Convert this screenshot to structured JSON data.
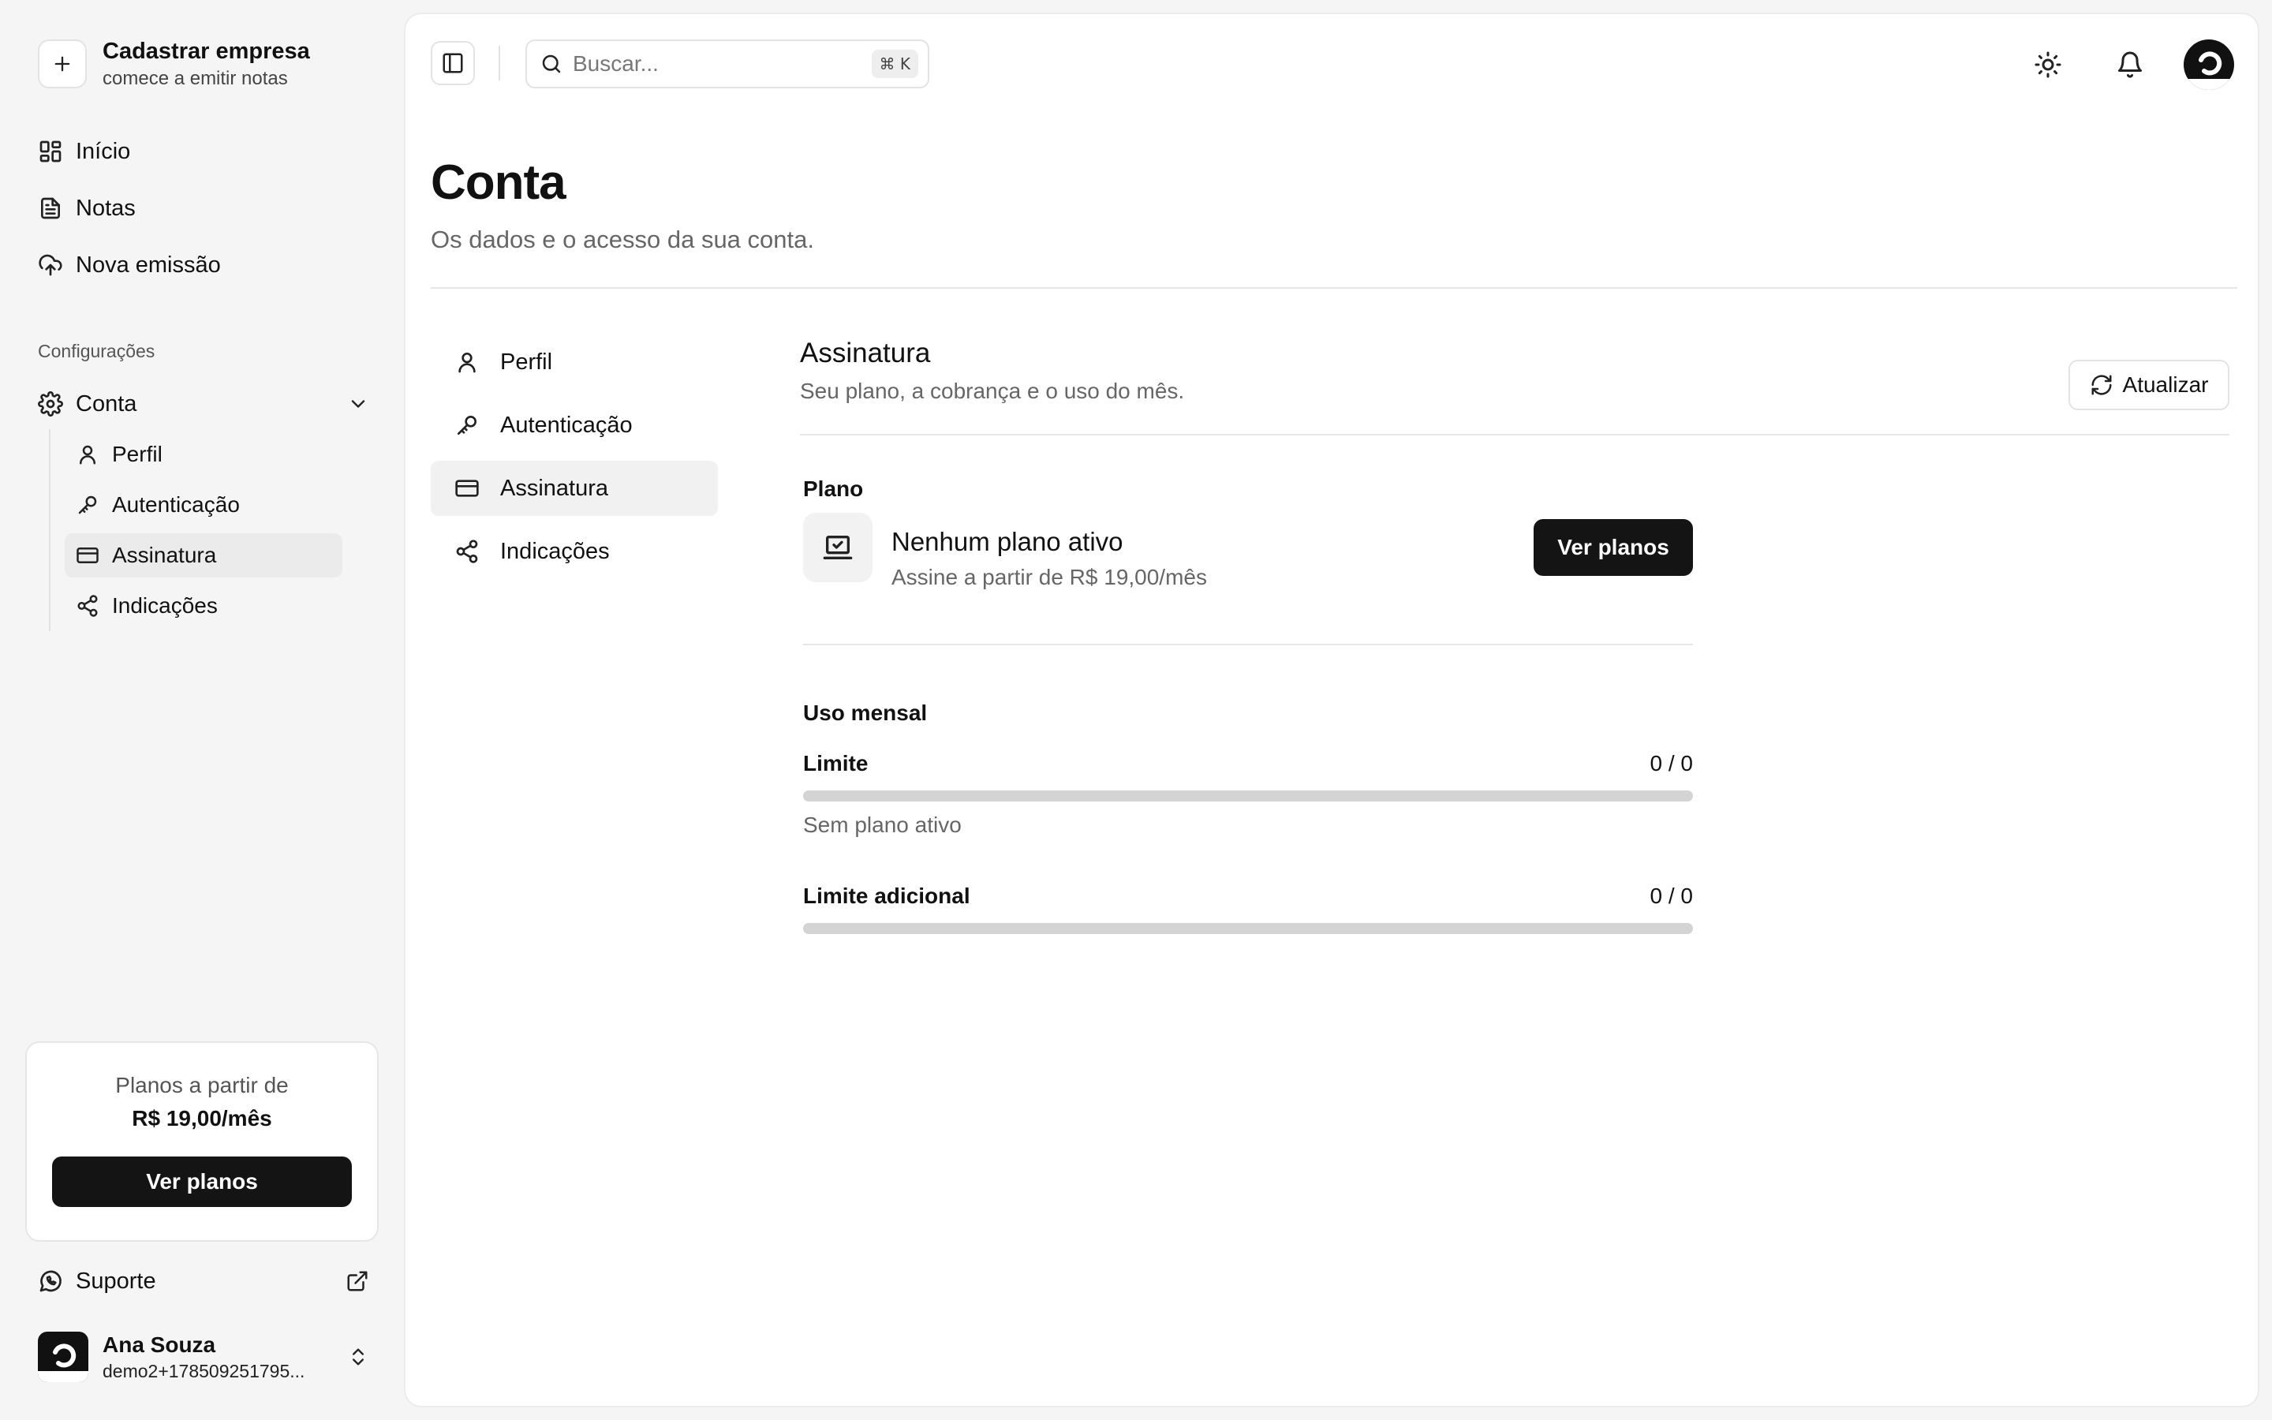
{
  "brand": {
    "title": "Cadastrar empresa",
    "subtitle": "comece a emitir notas"
  },
  "nav": [
    {
      "label": "Início",
      "icon": "grid-icon"
    },
    {
      "label": "Notas",
      "icon": "document-icon"
    },
    {
      "label": "Nova emissão",
      "icon": "cloud-upload-icon"
    }
  ],
  "settings": {
    "section_label": "Configurações",
    "group_label": "Conta",
    "items": [
      {
        "label": "Perfil",
        "icon": "user-icon"
      },
      {
        "label": "Autenticação",
        "icon": "key-icon"
      },
      {
        "label": "Assinatura",
        "icon": "credit-card-icon"
      },
      {
        "label": "Indicações",
        "icon": "share-icon"
      }
    ],
    "active_item": "Assinatura"
  },
  "promo": {
    "line1": "Planos a partir de",
    "price": "R$ 19,00/mês",
    "button": "Ver planos"
  },
  "support": {
    "label": "Suporte"
  },
  "user": {
    "name": "Ana Souza",
    "email": "demo2+178509251795..."
  },
  "topbar": {
    "search_placeholder": "Buscar...",
    "shortcut": "⌘ K"
  },
  "page": {
    "title": "Conta",
    "subtitle": "Os dados e o acesso da sua conta."
  },
  "account_tabs": [
    {
      "label": "Perfil",
      "icon": "user-icon"
    },
    {
      "label": "Autenticação",
      "icon": "key-icon"
    },
    {
      "label": "Assinatura",
      "icon": "credit-card-icon"
    },
    {
      "label": "Indicações",
      "icon": "share-icon"
    }
  ],
  "subscription": {
    "title": "Assinatura",
    "subtitle": "Seu plano, a cobrança e o uso do mês.",
    "refresh_label": "Atualizar",
    "plan": {
      "label": "Plano",
      "name": "Nenhum plano ativo",
      "description": "Assine a partir de R$ 19,00/mês",
      "button": "Ver planos"
    },
    "usage": {
      "label": "Uso mensal",
      "meters": [
        {
          "name": "Limite",
          "value": "0 / 0",
          "fill_fraction": 0,
          "note": "Sem plano ativo"
        },
        {
          "name": "Limite adicional",
          "value": "0 / 0",
          "fill_fraction": 0
        }
      ]
    }
  }
}
